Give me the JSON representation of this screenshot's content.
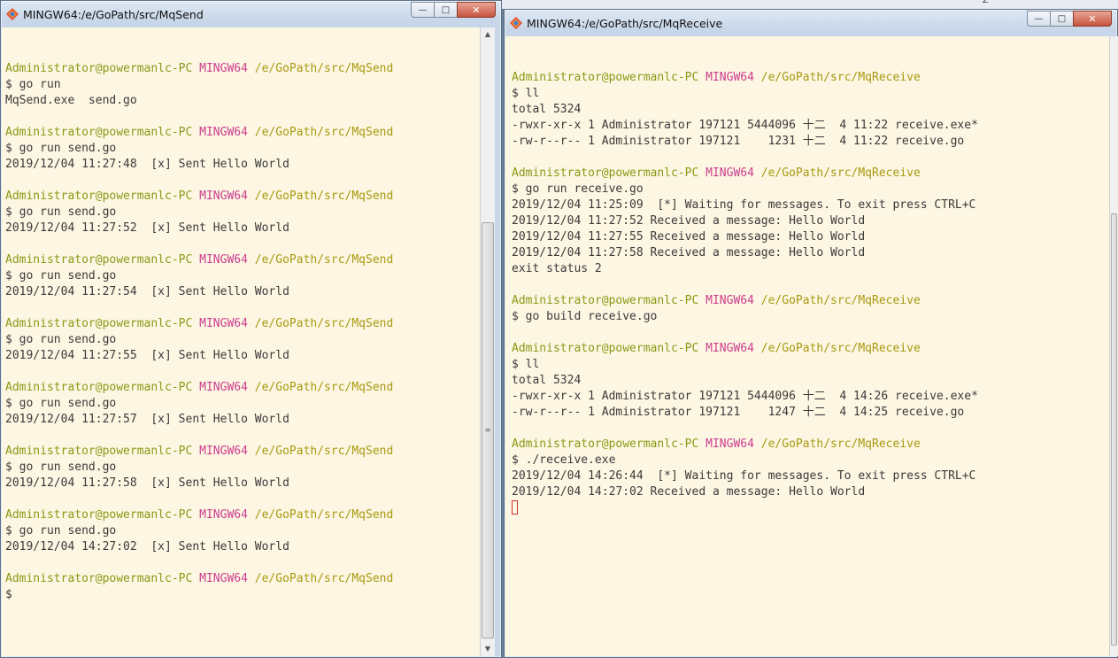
{
  "desktop": {
    "fragment": "Z"
  },
  "send_window": {
    "title": "MINGW64:/e/GoPath/src/MqSend",
    "controls": {
      "minimize": "—",
      "maximize": "□",
      "close": "✕"
    },
    "lines": [
      {
        "segments": []
      },
      {
        "segments": [
          {
            "t": "Administrator@powermanlc-PC",
            "c": "u"
          },
          {
            "t": " ",
            "c": ""
          },
          {
            "t": "MINGW64",
            "c": "h"
          },
          {
            "t": " ",
            "c": ""
          },
          {
            "t": "/e/GoPath/src/MqSend",
            "c": "p"
          }
        ]
      },
      {
        "segments": [
          {
            "t": "$ go run",
            "c": ""
          }
        ]
      },
      {
        "segments": [
          {
            "t": "MqSend.exe  send.go",
            "c": ""
          }
        ]
      },
      {
        "segments": []
      },
      {
        "segments": [
          {
            "t": "Administrator@powermanlc-PC",
            "c": "u"
          },
          {
            "t": " ",
            "c": ""
          },
          {
            "t": "MINGW64",
            "c": "h"
          },
          {
            "t": " ",
            "c": ""
          },
          {
            "t": "/e/GoPath/src/MqSend",
            "c": "p"
          }
        ]
      },
      {
        "segments": [
          {
            "t": "$ go run send.go",
            "c": ""
          }
        ]
      },
      {
        "segments": [
          {
            "t": "2019/12/04 11:27:48  [x] Sent Hello World",
            "c": ""
          }
        ]
      },
      {
        "segments": []
      },
      {
        "segments": [
          {
            "t": "Administrator@powermanlc-PC",
            "c": "u"
          },
          {
            "t": " ",
            "c": ""
          },
          {
            "t": "MINGW64",
            "c": "h"
          },
          {
            "t": " ",
            "c": ""
          },
          {
            "t": "/e/GoPath/src/MqSend",
            "c": "p"
          }
        ]
      },
      {
        "segments": [
          {
            "t": "$ go run send.go",
            "c": ""
          }
        ]
      },
      {
        "segments": [
          {
            "t": "2019/12/04 11:27:52  [x] Sent Hello World",
            "c": ""
          }
        ]
      },
      {
        "segments": []
      },
      {
        "segments": [
          {
            "t": "Administrator@powermanlc-PC",
            "c": "u"
          },
          {
            "t": " ",
            "c": ""
          },
          {
            "t": "MINGW64",
            "c": "h"
          },
          {
            "t": " ",
            "c": ""
          },
          {
            "t": "/e/GoPath/src/MqSend",
            "c": "p"
          }
        ]
      },
      {
        "segments": [
          {
            "t": "$ go run send.go",
            "c": ""
          }
        ]
      },
      {
        "segments": [
          {
            "t": "2019/12/04 11:27:54  [x] Sent Hello World",
            "c": ""
          }
        ]
      },
      {
        "segments": []
      },
      {
        "segments": [
          {
            "t": "Administrator@powermanlc-PC",
            "c": "u"
          },
          {
            "t": " ",
            "c": ""
          },
          {
            "t": "MINGW64",
            "c": "h"
          },
          {
            "t": " ",
            "c": ""
          },
          {
            "t": "/e/GoPath/src/MqSend",
            "c": "p"
          }
        ]
      },
      {
        "segments": [
          {
            "t": "$ go run send.go",
            "c": ""
          }
        ]
      },
      {
        "segments": [
          {
            "t": "2019/12/04 11:27:55  [x] Sent Hello World",
            "c": ""
          }
        ]
      },
      {
        "segments": []
      },
      {
        "segments": [
          {
            "t": "Administrator@powermanlc-PC",
            "c": "u"
          },
          {
            "t": " ",
            "c": ""
          },
          {
            "t": "MINGW64",
            "c": "h"
          },
          {
            "t": " ",
            "c": ""
          },
          {
            "t": "/e/GoPath/src/MqSend",
            "c": "p"
          }
        ]
      },
      {
        "segments": [
          {
            "t": "$ go run send.go",
            "c": ""
          }
        ]
      },
      {
        "segments": [
          {
            "t": "2019/12/04 11:27:57  [x] Sent Hello World",
            "c": ""
          }
        ]
      },
      {
        "segments": []
      },
      {
        "segments": [
          {
            "t": "Administrator@powermanlc-PC",
            "c": "u"
          },
          {
            "t": " ",
            "c": ""
          },
          {
            "t": "MINGW64",
            "c": "h"
          },
          {
            "t": " ",
            "c": ""
          },
          {
            "t": "/e/GoPath/src/MqSend",
            "c": "p"
          }
        ]
      },
      {
        "segments": [
          {
            "t": "$ go run send.go",
            "c": ""
          }
        ]
      },
      {
        "segments": [
          {
            "t": "2019/12/04 11:27:58  [x] Sent Hello World",
            "c": ""
          }
        ]
      },
      {
        "segments": []
      },
      {
        "segments": [
          {
            "t": "Administrator@powermanlc-PC",
            "c": "u"
          },
          {
            "t": " ",
            "c": ""
          },
          {
            "t": "MINGW64",
            "c": "h"
          },
          {
            "t": " ",
            "c": ""
          },
          {
            "t": "/e/GoPath/src/MqSend",
            "c": "p"
          }
        ]
      },
      {
        "segments": [
          {
            "t": "$ go run send.go",
            "c": ""
          }
        ]
      },
      {
        "segments": [
          {
            "t": "2019/12/04 14:27:02  [x] Sent Hello World",
            "c": ""
          }
        ]
      },
      {
        "segments": []
      },
      {
        "segments": [
          {
            "t": "Administrator@powermanlc-PC",
            "c": "u"
          },
          {
            "t": " ",
            "c": ""
          },
          {
            "t": "MINGW64",
            "c": "h"
          },
          {
            "t": " ",
            "c": ""
          },
          {
            "t": "/e/GoPath/src/MqSend",
            "c": "p"
          }
        ]
      },
      {
        "segments": [
          {
            "t": "$",
            "c": ""
          }
        ]
      }
    ]
  },
  "receive_window": {
    "title": "MINGW64:/e/GoPath/src/MqReceive",
    "controls": {
      "minimize": "—",
      "maximize": "□",
      "close": "✕"
    },
    "lines": [
      {
        "segments": []
      },
      {
        "segments": [
          {
            "t": "Administrator@powermanlc-PC",
            "c": "u"
          },
          {
            "t": " ",
            "c": ""
          },
          {
            "t": "MINGW64",
            "c": "h"
          },
          {
            "t": " ",
            "c": ""
          },
          {
            "t": "/e/GoPath/src/MqReceive",
            "c": "p"
          }
        ]
      },
      {
        "segments": [
          {
            "t": "$ ll",
            "c": ""
          }
        ]
      },
      {
        "segments": [
          {
            "t": "total 5324",
            "c": ""
          }
        ]
      },
      {
        "segments": [
          {
            "t": "-rwxr-xr-x 1 Administrator 197121 5444096 十二  4 11:22 receive.exe*",
            "c": ""
          }
        ]
      },
      {
        "segments": [
          {
            "t": "-rw-r--r-- 1 Administrator 197121    1231 十二  4 11:22 receive.go",
            "c": ""
          }
        ]
      },
      {
        "segments": []
      },
      {
        "segments": [
          {
            "t": "Administrator@powermanlc-PC",
            "c": "u"
          },
          {
            "t": " ",
            "c": ""
          },
          {
            "t": "MINGW64",
            "c": "h"
          },
          {
            "t": " ",
            "c": ""
          },
          {
            "t": "/e/GoPath/src/MqReceive",
            "c": "p"
          }
        ]
      },
      {
        "segments": [
          {
            "t": "$ go run receive.go",
            "c": ""
          }
        ]
      },
      {
        "segments": [
          {
            "t": "2019/12/04 11:25:09  [*] Waiting for messages. To exit press CTRL+C",
            "c": ""
          }
        ]
      },
      {
        "segments": [
          {
            "t": "2019/12/04 11:27:52 Received a message: Hello World",
            "c": ""
          }
        ]
      },
      {
        "segments": [
          {
            "t": "2019/12/04 11:27:55 Received a message: Hello World",
            "c": ""
          }
        ]
      },
      {
        "segments": [
          {
            "t": "2019/12/04 11:27:58 Received a message: Hello World",
            "c": ""
          }
        ]
      },
      {
        "segments": [
          {
            "t": "exit status 2",
            "c": ""
          }
        ]
      },
      {
        "segments": []
      },
      {
        "segments": [
          {
            "t": "Administrator@powermanlc-PC",
            "c": "u"
          },
          {
            "t": " ",
            "c": ""
          },
          {
            "t": "MINGW64",
            "c": "h"
          },
          {
            "t": " ",
            "c": ""
          },
          {
            "t": "/e/GoPath/src/MqReceive",
            "c": "p"
          }
        ]
      },
      {
        "segments": [
          {
            "t": "$ go build receive.go",
            "c": ""
          }
        ]
      },
      {
        "segments": []
      },
      {
        "segments": [
          {
            "t": "Administrator@powermanlc-PC",
            "c": "u"
          },
          {
            "t": " ",
            "c": ""
          },
          {
            "t": "MINGW64",
            "c": "h"
          },
          {
            "t": " ",
            "c": ""
          },
          {
            "t": "/e/GoPath/src/MqReceive",
            "c": "p"
          }
        ]
      },
      {
        "segments": [
          {
            "t": "$ ll",
            "c": ""
          }
        ]
      },
      {
        "segments": [
          {
            "t": "total 5324",
            "c": ""
          }
        ]
      },
      {
        "segments": [
          {
            "t": "-rwxr-xr-x 1 Administrator 197121 5444096 十二  4 14:26 receive.exe*",
            "c": ""
          }
        ]
      },
      {
        "segments": [
          {
            "t": "-rw-r--r-- 1 Administrator 197121    1247 十二  4 14:25 receive.go",
            "c": ""
          }
        ]
      },
      {
        "segments": []
      },
      {
        "segments": [
          {
            "t": "Administrator@powermanlc-PC",
            "c": "u"
          },
          {
            "t": " ",
            "c": ""
          },
          {
            "t": "MINGW64",
            "c": "h"
          },
          {
            "t": " ",
            "c": ""
          },
          {
            "t": "/e/GoPath/src/MqReceive",
            "c": "p"
          }
        ]
      },
      {
        "segments": [
          {
            "t": "$ ./receive.exe",
            "c": ""
          }
        ]
      },
      {
        "segments": [
          {
            "t": "2019/12/04 14:26:44  [*] Waiting for messages. To exit press CTRL+C",
            "c": ""
          }
        ]
      },
      {
        "segments": [
          {
            "t": "2019/12/04 14:27:02 Received a message: Hello World",
            "c": ""
          }
        ]
      },
      {
        "segments": [
          {
            "t": "",
            "c": "cursor"
          }
        ]
      }
    ]
  },
  "icons": {
    "app": "git-bash-diamond-icon",
    "scroll_up": "scroll-up-arrow-icon",
    "scroll_down": "scroll-down-arrow-icon",
    "grip": "scroll-grip-icon"
  },
  "colors": {
    "user": "#8a9a16",
    "host": "#cc3d8e",
    "path": "#a89a10",
    "terminal_bg": "#fdf6e3"
  }
}
